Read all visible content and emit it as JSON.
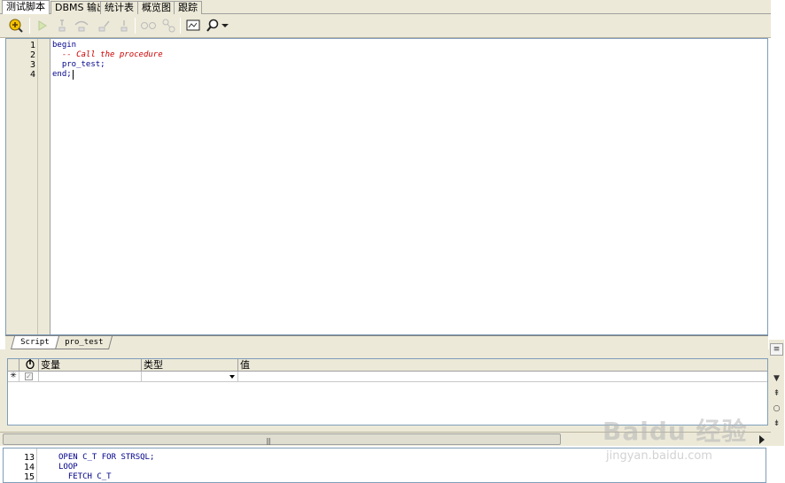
{
  "tabs": [
    {
      "label": "测试脚本",
      "active": true
    },
    {
      "label": "DBMS 输出",
      "active": false
    },
    {
      "label": "统计表",
      "active": false
    },
    {
      "label": "概览图",
      "active": false
    },
    {
      "label": "跟踪",
      "active": false
    }
  ],
  "toolbar": {
    "icons": [
      "debug-run-icon",
      "run-icon",
      "step-into-icon",
      "step-over-icon",
      "step-out-icon",
      "run-to-exception-icon",
      "breakpoint-icon",
      "toggle-breakpoint-icon",
      "screen-icon",
      "search-icon",
      "dropdown-arrow-icon"
    ]
  },
  "editor": {
    "lines": [
      {
        "num": "1",
        "text": "begin"
      },
      {
        "num": "2",
        "text": "  -- Call the procedure"
      },
      {
        "num": "3",
        "text": "  pro_test;"
      },
      {
        "num": "4",
        "text": "end;"
      }
    ]
  },
  "source_tabs": [
    {
      "label": "Script",
      "active": true
    },
    {
      "label": "pro_test",
      "active": false
    }
  ],
  "variables": {
    "headers": [
      "变量",
      "类型",
      "值"
    ],
    "row_marker": "✳",
    "type_value": ""
  },
  "snippet": {
    "lines": [
      {
        "num": "13",
        "text": "OPEN C_T FOR STRSQL;"
      },
      {
        "num": "14",
        "text": "LOOP"
      },
      {
        "num": "15",
        "text": "  FETCH C_T"
      }
    ]
  },
  "watermark": {
    "brand": "Baidu 经验",
    "url": "jingyan.baidu.com"
  },
  "colors": {
    "keyword": "#00008b",
    "comment": "#cc0000",
    "chrome": "#ece9d8",
    "border": "#7f9db9"
  }
}
